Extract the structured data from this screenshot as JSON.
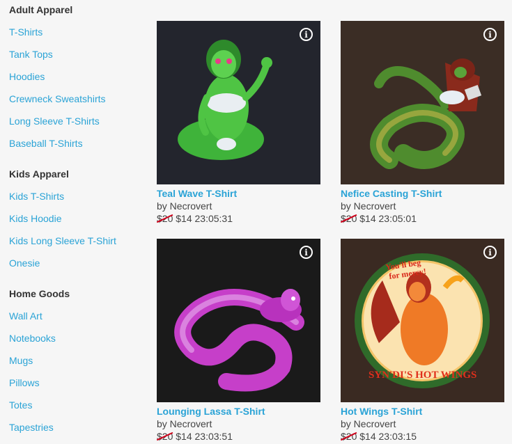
{
  "sidebar": {
    "sections": [
      {
        "heading": "Adult Apparel",
        "items": [
          "T-Shirts",
          "Tank Tops",
          "Hoodies",
          "Crewneck Sweatshirts",
          "Long Sleeve T-Shirts",
          "Baseball T-Shirts"
        ]
      },
      {
        "heading": "Kids Apparel",
        "items": [
          "Kids T-Shirts",
          "Kids Hoodie",
          "Kids Long Sleeve T-Shirt",
          "Onesie"
        ]
      },
      {
        "heading": "Home Goods",
        "items": [
          "Wall Art",
          "Notebooks",
          "Mugs",
          "Pillows",
          "Totes",
          "Tapestries"
        ]
      }
    ]
  },
  "products": [
    {
      "title": "Teal Wave T-Shirt",
      "artist": "by Necrovert",
      "old_price": "$20",
      "price": "$14",
      "countdown": "23:05:31",
      "bg_color": "#23252d",
      "info_icon": "i"
    },
    {
      "title": "Nefice Casting T-Shirt",
      "artist": "by Necrovert",
      "old_price": "$20",
      "price": "$14",
      "countdown": "23:05:01",
      "bg_color": "#3b2d25",
      "info_icon": "i"
    },
    {
      "title": "Lounging Lassa T-Shirt",
      "artist": "by Necrovert",
      "old_price": "$20",
      "price": "$14",
      "countdown": "23:03:51",
      "bg_color": "#1a1a1a",
      "info_icon": "i"
    },
    {
      "title": "Hot Wings T-Shirt",
      "artist": "by Necrovert",
      "old_price": "$20",
      "price": "$14",
      "countdown": "23:03:15",
      "bg_color": "#3a2a22",
      "info_icon": "i",
      "art_text": {
        "tagline_1": "You'll beg",
        "tagline_2": "for mercy!",
        "banner": "SYN'DI'S HOT WINGS"
      }
    }
  ],
  "colors": {
    "link": "#2aa3d6",
    "heading": "#333333",
    "strike": "#d0021b",
    "page_bg": "#f6f6f6"
  }
}
